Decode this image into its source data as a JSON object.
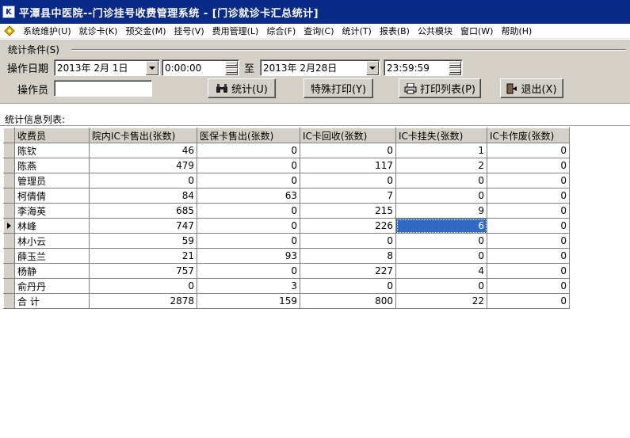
{
  "window": {
    "title": "平潭县中医院--门诊挂号收费管理系统 - [门诊就诊卡汇总统计]"
  },
  "menu": [
    {
      "label": "系统维护(U)"
    },
    {
      "label": "就诊卡(K)"
    },
    {
      "label": "预交金(M)"
    },
    {
      "label": "挂号(V)"
    },
    {
      "label": "费用管理(L)"
    },
    {
      "label": "综合(F)"
    },
    {
      "label": "查询(C)"
    },
    {
      "label": "统计(T)"
    },
    {
      "label": "报表(B)"
    },
    {
      "label": "公共模块"
    },
    {
      "label": "窗口(W)"
    },
    {
      "label": "帮助(H)"
    }
  ],
  "criteria": {
    "group_label": "统计条件(S)",
    "date_label": "操作日期",
    "start_date": "2013年  2月  1日",
    "start_time": "0:00:00",
    "to_label": "至",
    "end_date": "2013年  2月28日",
    "end_time": "23:59:59",
    "operator_label": "操作员",
    "operator_value": ""
  },
  "buttons": {
    "stat": "统计(U)",
    "special_print": "特殊打印(Y)",
    "print_list": "打印列表(P)",
    "exit": "退出(X)"
  },
  "list_label": "统计信息列表:",
  "table": {
    "columns": [
      "收费员",
      "院内IC卡售出(张数)",
      "医保卡售出(张数)",
      "IC卡回收(张数)",
      "IC卡挂失(张数)",
      "IC卡作废(张数)"
    ],
    "rows": [
      [
        "陈钦",
        "46",
        "0",
        "0",
        "1",
        "0"
      ],
      [
        "陈燕",
        "479",
        "0",
        "117",
        "2",
        "0"
      ],
      [
        "管理员",
        "0",
        "0",
        "0",
        "0",
        "0"
      ],
      [
        "柯倩倩",
        "84",
        "63",
        "7",
        "0",
        "0"
      ],
      [
        "李海英",
        "685",
        "0",
        "215",
        "9",
        "0"
      ],
      [
        "林峰",
        "747",
        "0",
        "226",
        "6",
        "0"
      ],
      [
        "林小云",
        "59",
        "0",
        "0",
        "0",
        "0"
      ],
      [
        "薛玉兰",
        "21",
        "93",
        "8",
        "0",
        "0"
      ],
      [
        "杨静",
        "757",
        "0",
        "227",
        "4",
        "0"
      ],
      [
        "俞丹丹",
        "0",
        "3",
        "0",
        "0",
        "0"
      ],
      [
        "合   计",
        "2878",
        "159",
        "800",
        "22",
        "0"
      ]
    ]
  },
  "colors": {
    "title_bar": "#0a2a8a",
    "panel": "#d4d0c8",
    "selection": "#316ac5"
  }
}
